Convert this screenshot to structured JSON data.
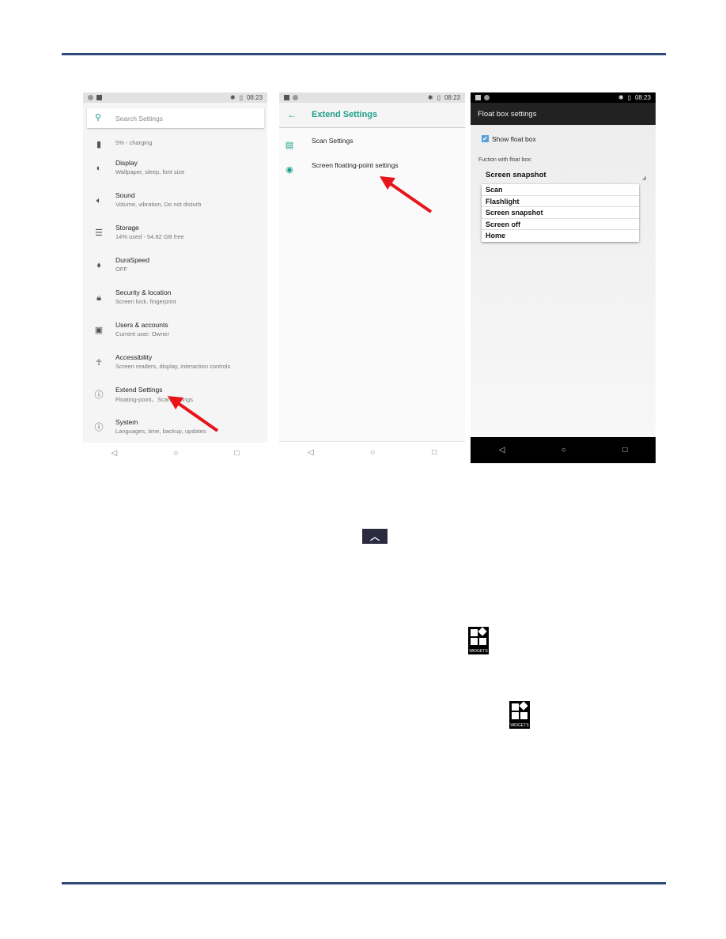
{
  "status_time": "08:23",
  "screen1": {
    "search_placeholder": "Search Settings",
    "items": [
      {
        "title": "",
        "subtitle": "5% - charging",
        "icon": "battery-icon"
      },
      {
        "title": "Display",
        "subtitle": "Wallpaper, sleep, font size",
        "icon": "brightness-icon"
      },
      {
        "title": "Sound",
        "subtitle": "Volume, vibration, Do not disturb",
        "icon": "volume-icon"
      },
      {
        "title": "Storage",
        "subtitle": "14% used - 54.82 GB free",
        "icon": "storage-icon"
      },
      {
        "title": "DuraSpeed",
        "subtitle": "OFF",
        "icon": "rocket-icon"
      },
      {
        "title": "Security & location",
        "subtitle": "Screen lock, fingerprint",
        "icon": "lock-icon"
      },
      {
        "title": "Users & accounts",
        "subtitle": "Current user: Owner",
        "icon": "account-icon"
      },
      {
        "title": "Accessibility",
        "subtitle": "Screen readers, display, interaction controls",
        "icon": "accessibility-icon"
      },
      {
        "title": "Extend Settings",
        "subtitle": "Floating-point、Scan settings",
        "icon": "info-icon"
      },
      {
        "title": "System",
        "subtitle": "Languages, time, backup, updates",
        "icon": "info-icon"
      }
    ]
  },
  "screen2": {
    "title": "Extend Settings",
    "accent": "#1e9e8a",
    "items": [
      "Scan Settings",
      "Screen floating-point settings"
    ]
  },
  "screen3": {
    "title": "Float box settings",
    "checkbox_label": "Show float box",
    "checked": true,
    "function_label": "Fuction with float box:",
    "selected": "Screen snapshot",
    "options": [
      "Scan",
      "Flashlight",
      "Screen snapshot",
      "Screen off",
      "Home"
    ]
  },
  "icons": {
    "widgets_label": "WIDGETS"
  },
  "colors": {
    "rule": "#2e4a7a",
    "arrow": "#e8141a"
  }
}
